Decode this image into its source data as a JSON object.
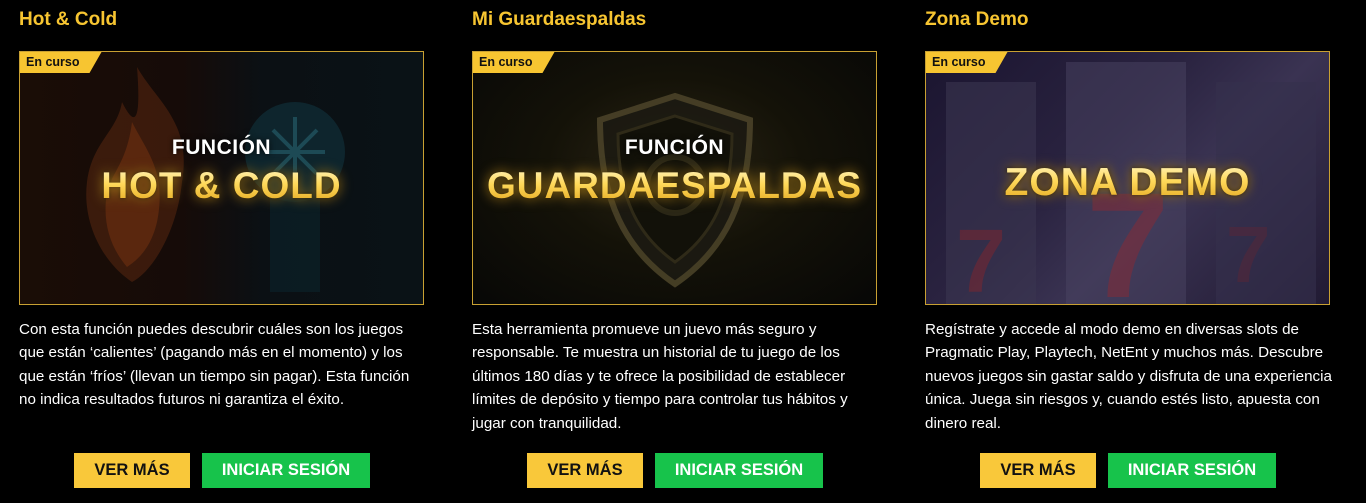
{
  "colors": {
    "accent": "#f7c531",
    "login": "#17c34b",
    "background": "#000000"
  },
  "cards": [
    {
      "title": "Hot & Cold",
      "badge": "En curso",
      "banner_small": "FUNCIÓN",
      "banner_big": "HOT & COLD",
      "description": "Con esta función puedes descubrir cuáles son los juegos que están ‘calientes’ (pagando más en el momento) y los que están ‘fríos’ (llevan un tiempo sin pagar). Esta función no indica resultados futuros ni garantiza el éxito.",
      "more_label": "VER MÁS",
      "login_label": "INICIAR SESIÓN"
    },
    {
      "title": "Mi Guardaespaldas",
      "badge": "En curso",
      "banner_small": "FUNCIÓN",
      "banner_big": "GUARDAESPALDAS",
      "description": "Esta herramienta promueve un juevo más seguro y responsable. Te muestra un historial de tu juego de los últimos 180 días y te ofrece la posibilidad de establecer límites de depósito y tiempo para controlar tus hábitos y jugar con tranquilidad.",
      "more_label": "VER MÁS",
      "login_label": "INICIAR SESIÓN"
    },
    {
      "title": "Zona Demo",
      "badge": "En curso",
      "banner_big": "ZONA DEMO",
      "description": "Regístrate y accede al modo demo en diversas slots de Pragmatic Play, Playtech, NetEnt y muchos más. Descubre nuevos juegos sin gastar saldo y disfruta de una experiencia única. Juega sin riesgos y, cuando estés listo, apuesta con dinero real.",
      "more_label": "VER MÁS",
      "login_label": "INICIAR SESIÓN"
    }
  ]
}
